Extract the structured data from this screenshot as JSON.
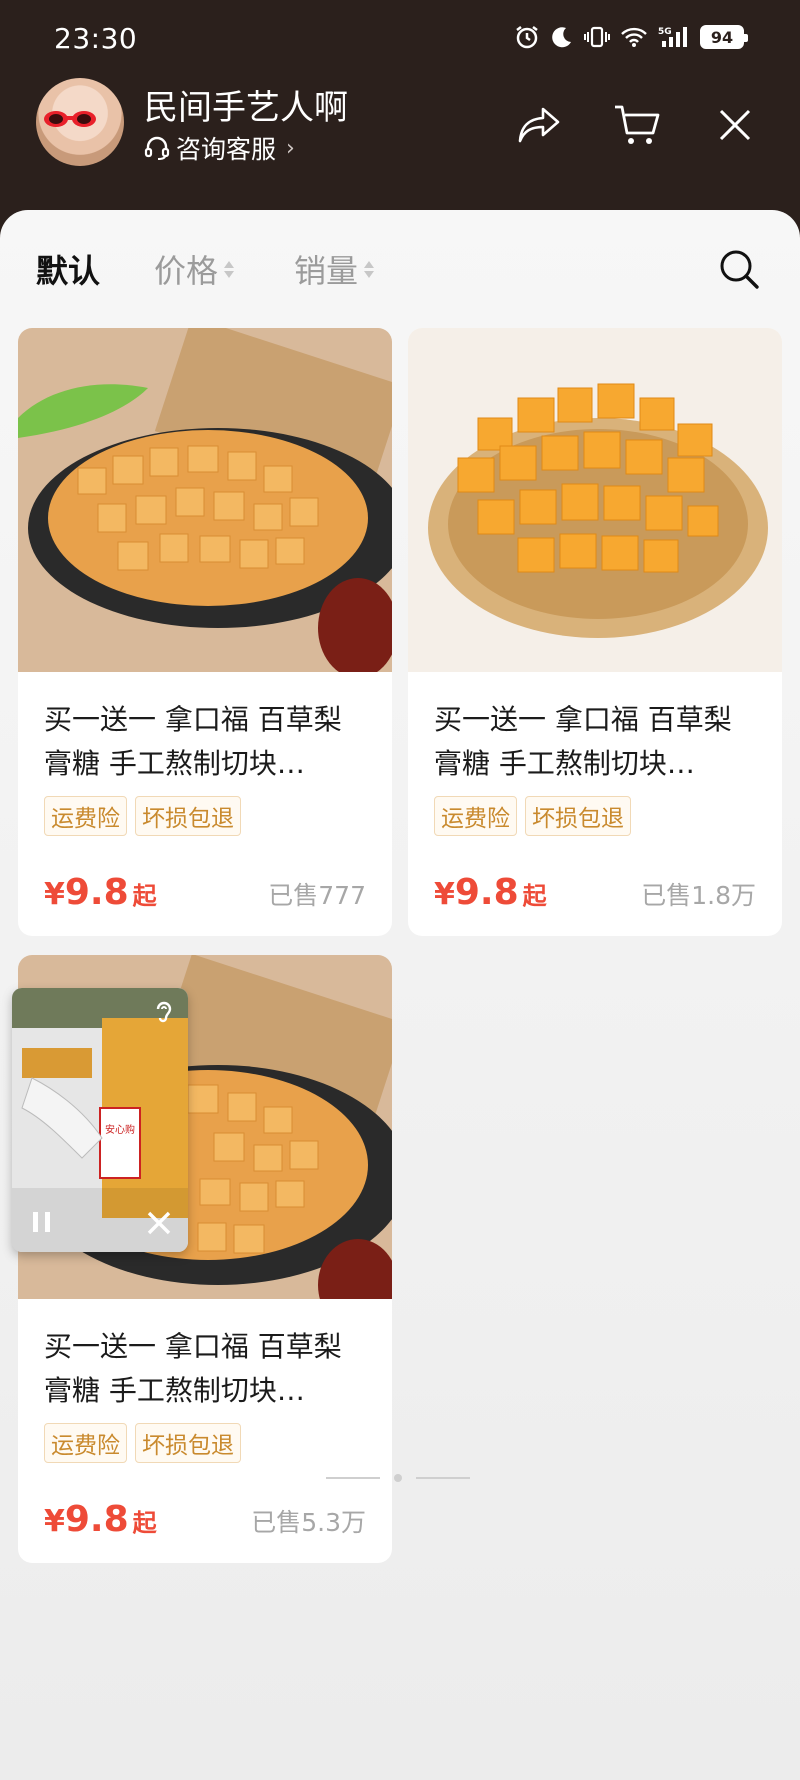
{
  "status_bar": {
    "time": "23:30",
    "battery": "94",
    "network": "5G"
  },
  "header": {
    "shop_name": "民间手艺人啊",
    "customer_service": "咨询客服"
  },
  "sort_bar": {
    "default": "默认",
    "price": "价格",
    "sales": "销量"
  },
  "products": [
    {
      "title": "买一送一 拿口福 百草梨膏糖 手工熬制切块…",
      "tags": [
        "运费险",
        "坏损包退"
      ],
      "currency": "¥",
      "price": "9.8",
      "price_suffix": "起",
      "sold": "已售777"
    },
    {
      "title": "买一送一 拿口福 百草梨膏糖 手工熬制切块…",
      "tags": [
        "运费险",
        "坏损包退"
      ],
      "currency": "¥",
      "price": "9.8",
      "price_suffix": "起",
      "sold": "已售1.8万"
    },
    {
      "title": "买一送一 拿口福 百草梨膏糖 手工熬制切块…",
      "tags": [
        "运费险",
        "坏损包退"
      ],
      "currency": "¥",
      "price": "9.8",
      "price_suffix": "起",
      "sold": "已售5.3万"
    }
  ],
  "pip_video": {
    "sign_text": "安心购"
  },
  "colors": {
    "header_bg": "#2b201c",
    "price": "#ee4b38",
    "tag": "#c98a2e"
  }
}
